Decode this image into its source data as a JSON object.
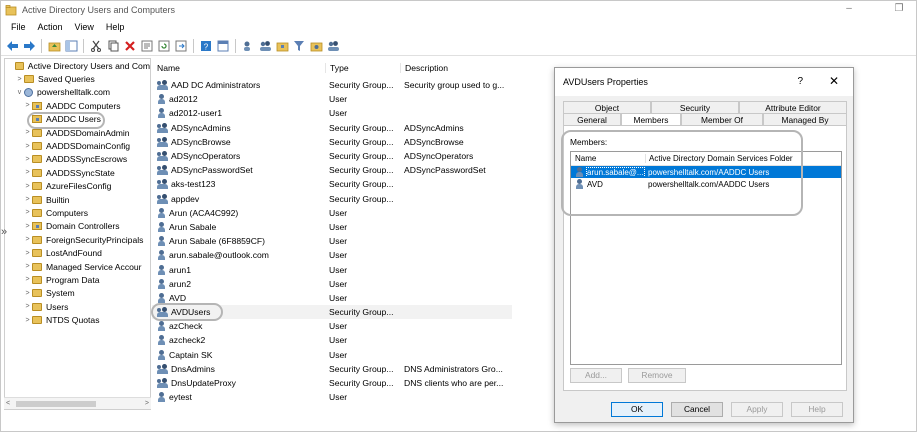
{
  "window": {
    "title": "Active Directory Users and Computers"
  },
  "menu": [
    "File",
    "Action",
    "View",
    "Help"
  ],
  "tree": {
    "items": [
      {
        "label": "Active Directory Users and Com",
        "icon": "aduc-icon",
        "expander": ""
      },
      {
        "label": "Saved Queries",
        "icon": "folder-icon",
        "expander": ">"
      },
      {
        "label": "powershelltalk.com",
        "icon": "domain-icon",
        "expander": "v"
      },
      {
        "label": "AADDC Computers",
        "icon": "ou-icon",
        "expander": ">"
      },
      {
        "label": "AADDC Users",
        "icon": "ou-icon",
        "expander": ""
      },
      {
        "label": "AADDSDomainAdmin",
        "icon": "folder-icon",
        "expander": ">"
      },
      {
        "label": "AADDSDomainConfig",
        "icon": "folder-icon",
        "expander": ">"
      },
      {
        "label": "AADDSSyncEscrows",
        "icon": "folder-icon",
        "expander": ">"
      },
      {
        "label": "AADDSSyncState",
        "icon": "folder-icon",
        "expander": ">"
      },
      {
        "label": "AzureFilesConfig",
        "icon": "folder-icon",
        "expander": ">"
      },
      {
        "label": "Builtin",
        "icon": "folder-icon",
        "expander": ">"
      },
      {
        "label": "Computers",
        "icon": "folder-icon",
        "expander": ">"
      },
      {
        "label": "Domain Controllers",
        "icon": "ou-icon",
        "expander": ">"
      },
      {
        "label": "ForeignSecurityPrincipals",
        "icon": "folder-icon",
        "expander": ">"
      },
      {
        "label": "LostAndFound",
        "icon": "folder-icon",
        "expander": ">"
      },
      {
        "label": "Managed Service Accour",
        "icon": "folder-icon",
        "expander": ">"
      },
      {
        "label": "Program Data",
        "icon": "folder-icon",
        "expander": ">"
      },
      {
        "label": "System",
        "icon": "folder-icon",
        "expander": ">"
      },
      {
        "label": "Users",
        "icon": "folder-icon",
        "expander": ">"
      },
      {
        "label": "NTDS Quotas",
        "icon": "folder-icon",
        "expander": ">"
      }
    ]
  },
  "list": {
    "headers": {
      "name": "Name",
      "type": "Type",
      "description": "Description"
    },
    "rows": [
      {
        "name": "AAD DC Administrators",
        "type": "Security Group...",
        "desc": "Security group used to g...",
        "kind": "group"
      },
      {
        "name": "ad2012",
        "type": "User",
        "desc": "",
        "kind": "user"
      },
      {
        "name": "ad2012-user1",
        "type": "User",
        "desc": "",
        "kind": "user"
      },
      {
        "name": "ADSyncAdmins",
        "type": "Security Group...",
        "desc": "ADSyncAdmins",
        "kind": "group"
      },
      {
        "name": "ADSyncBrowse",
        "type": "Security Group...",
        "desc": "ADSyncBrowse",
        "kind": "group"
      },
      {
        "name": "ADSyncOperators",
        "type": "Security Group...",
        "desc": "ADSyncOperators",
        "kind": "group"
      },
      {
        "name": "ADSyncPasswordSet",
        "type": "Security Group...",
        "desc": "ADSyncPasswordSet",
        "kind": "group"
      },
      {
        "name": "aks-test123",
        "type": "Security Group...",
        "desc": "",
        "kind": "group"
      },
      {
        "name": "appdev",
        "type": "Security Group...",
        "desc": "",
        "kind": "group"
      },
      {
        "name": "Arun (ACA4C992)",
        "type": "User",
        "desc": "",
        "kind": "user"
      },
      {
        "name": "Arun Sabale",
        "type": "User",
        "desc": "",
        "kind": "user"
      },
      {
        "name": "Arun Sabale (6F8859CF)",
        "type": "User",
        "desc": "",
        "kind": "user"
      },
      {
        "name": "arun.sabale@outlook.com",
        "type": "User",
        "desc": "",
        "kind": "user"
      },
      {
        "name": "arun1",
        "type": "User",
        "desc": "",
        "kind": "user"
      },
      {
        "name": "arun2",
        "type": "User",
        "desc": "",
        "kind": "user"
      },
      {
        "name": "AVD",
        "type": "User",
        "desc": "",
        "kind": "user"
      },
      {
        "name": "AVDUsers",
        "type": "Security Group...",
        "desc": "",
        "kind": "group"
      },
      {
        "name": "azCheck",
        "type": "User",
        "desc": "",
        "kind": "user"
      },
      {
        "name": "azcheck2",
        "type": "User",
        "desc": "",
        "kind": "user"
      },
      {
        "name": "Captain SK",
        "type": "User",
        "desc": "",
        "kind": "user"
      },
      {
        "name": "DnsAdmins",
        "type": "Security Group...",
        "desc": "DNS Administrators Gro...",
        "kind": "group"
      },
      {
        "name": "DnsUpdateProxy",
        "type": "Security Group...",
        "desc": "DNS clients who are per...",
        "kind": "group"
      },
      {
        "name": "eytest",
        "type": "User",
        "desc": "",
        "kind": "user"
      }
    ]
  },
  "dialog": {
    "title": "AVDUsers Properties",
    "help_glyph": "?",
    "close_glyph": "✕",
    "tabs_back": [
      "Object",
      "Security",
      "Attribute Editor"
    ],
    "tabs_front": [
      "General",
      "Members",
      "Member Of",
      "Managed By"
    ],
    "active_tab": "Members",
    "members_label": "Members:",
    "members_headers": {
      "name": "Name",
      "folder": "Active Directory Domain Services Folder"
    },
    "members": [
      {
        "name": "arun.sabale@...",
        "folder": "powershelltalk.com/AADDC Users",
        "selected": true
      },
      {
        "name": "AVD",
        "folder": "powershelltalk.com/AADDC Users",
        "selected": false
      }
    ],
    "buttons": {
      "add": "Add...",
      "remove": "Remove",
      "ok": "OK",
      "cancel": "Cancel",
      "apply": "Apply",
      "help": "Help"
    }
  },
  "colors": {
    "selection": "#0078d7",
    "callout": "#b5b5b5",
    "folder": "#e8c25a"
  }
}
